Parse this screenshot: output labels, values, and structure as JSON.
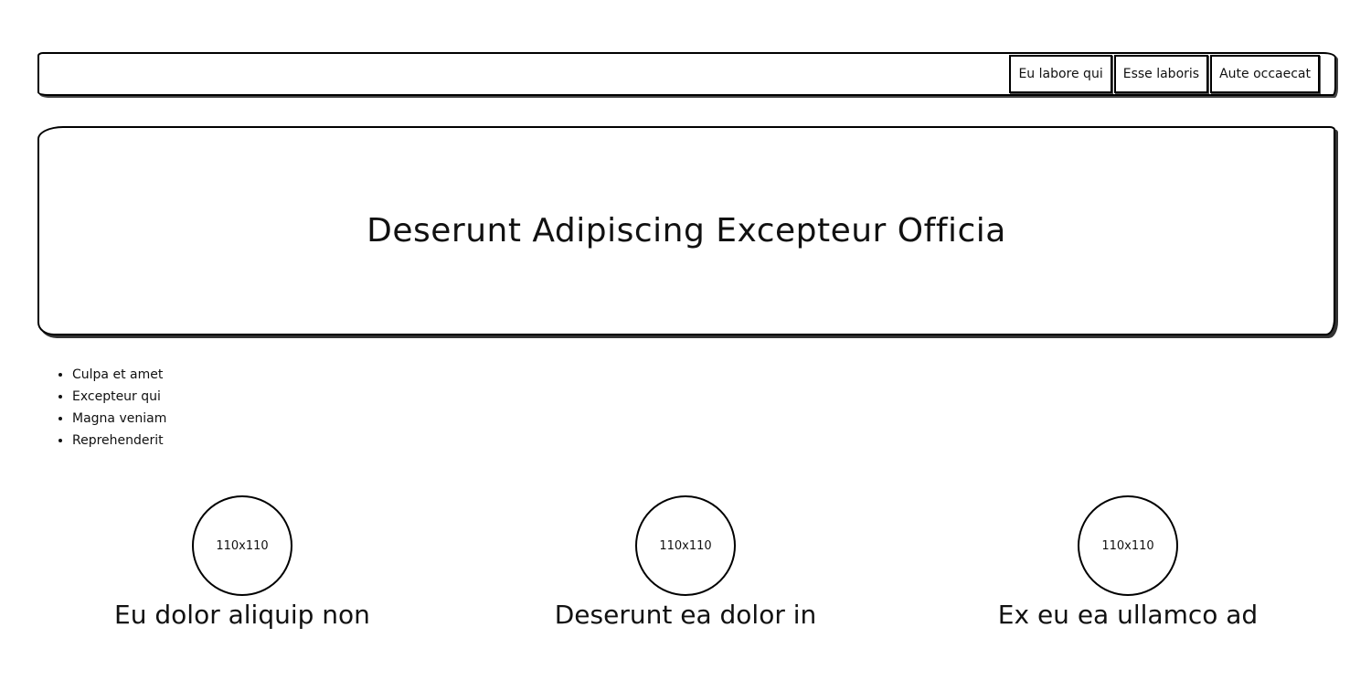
{
  "nav": {
    "items": [
      {
        "label": "Eu labore qui"
      },
      {
        "label": "Esse laboris"
      },
      {
        "label": "Aute occaecat"
      }
    ]
  },
  "hero": {
    "title": "Deserunt Adipiscing Excepteur Officia"
  },
  "list": {
    "items": [
      "Culpa et amet",
      "Excepteur qui",
      "Magna veniam",
      "Reprehenderit"
    ]
  },
  "cards": [
    {
      "image_label": "110x110",
      "title": "Eu dolor aliquip non"
    },
    {
      "image_label": "110x110",
      "title": "Deserunt ea dolor in"
    },
    {
      "image_label": "110x110",
      "title": "Ex eu ea ullamco ad"
    }
  ]
}
